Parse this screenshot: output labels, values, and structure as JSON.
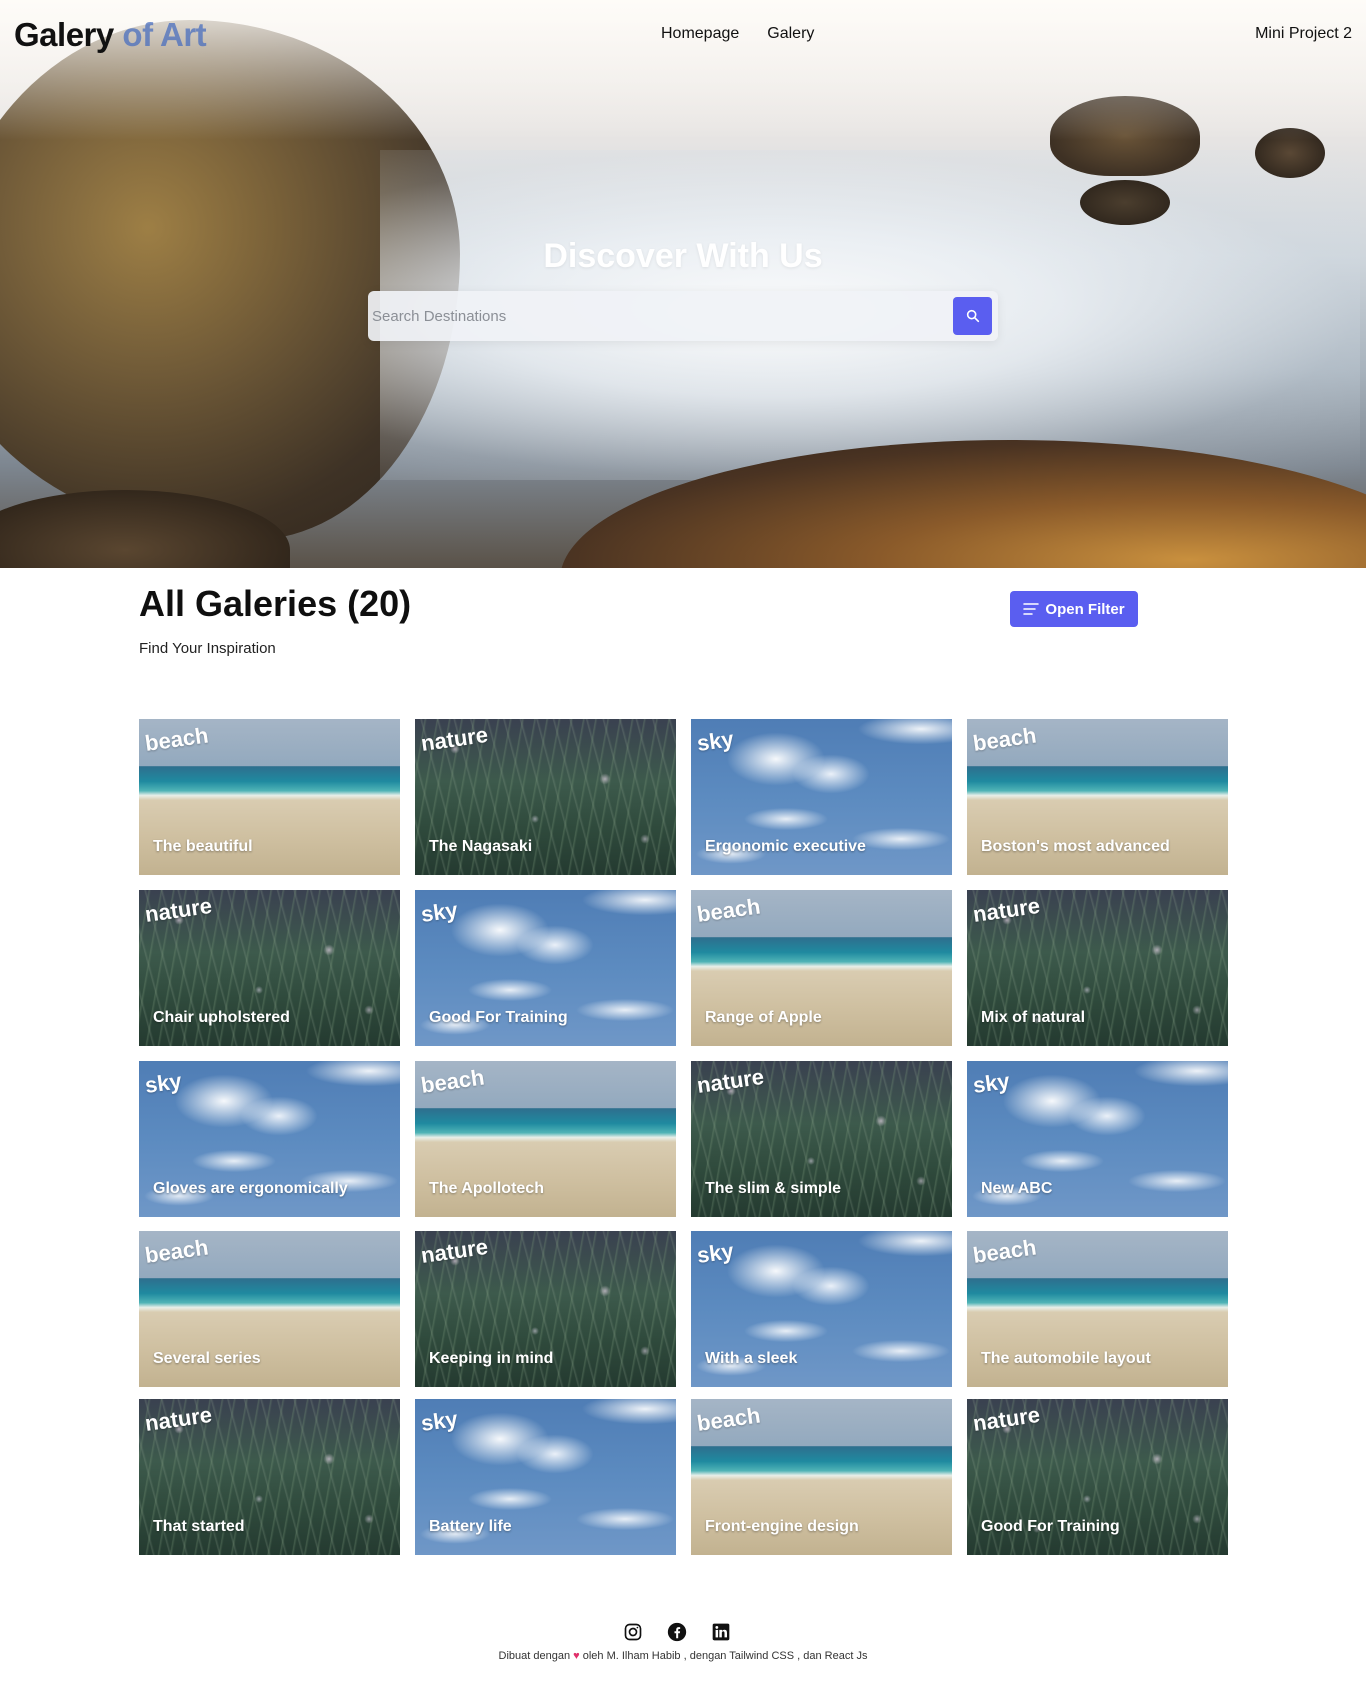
{
  "nav": {
    "logo_main": "Galery",
    "logo_accent": " of Art",
    "links": [
      "Homepage",
      "Galery"
    ],
    "right_label": "Mini Project 2"
  },
  "hero": {
    "title": "Discover With Us",
    "search_placeholder": "Search Destinations",
    "search_icon": "search-icon"
  },
  "section": {
    "title": "All Galeries (20)",
    "subtitle": "Find Your Inspiration",
    "filter_label": "Open Filter",
    "filter_icon": "filter-lines-icon"
  },
  "gallery": [
    {
      "tag": "beach",
      "title": "The beautiful"
    },
    {
      "tag": "nature",
      "title": "The Nagasaki"
    },
    {
      "tag": "sky",
      "title": "Ergonomic executive"
    },
    {
      "tag": "beach",
      "title": "Boston's most advanced"
    },
    {
      "tag": "nature",
      "title": "Chair upholstered"
    },
    {
      "tag": "sky",
      "title": "Good For Training"
    },
    {
      "tag": "beach",
      "title": "Range of Apple"
    },
    {
      "tag": "nature",
      "title": "Mix of natural"
    },
    {
      "tag": "sky",
      "title": "Gloves are ergonomically"
    },
    {
      "tag": "beach",
      "title": "The Apollotech"
    },
    {
      "tag": "nature",
      "title": "The slim & simple"
    },
    {
      "tag": "sky",
      "title": "New ABC"
    },
    {
      "tag": "beach",
      "title": "Several series"
    },
    {
      "tag": "nature",
      "title": "Keeping in mind"
    },
    {
      "tag": "sky",
      "title": "With a sleek"
    },
    {
      "tag": "beach",
      "title": "The automobile layout"
    },
    {
      "tag": "nature",
      "title": "That started"
    },
    {
      "tag": "sky",
      "title": "Battery life"
    },
    {
      "tag": "beach",
      "title": "Front-engine design"
    },
    {
      "tag": "nature",
      "title": "Good For Training"
    }
  ],
  "footer": {
    "icons": [
      "instagram-icon",
      "facebook-icon",
      "linkedin-icon"
    ],
    "text_before": "Dibuat dengan ",
    "heart": "♥",
    "text_after": " oleh M. Ilham Habib , dengan Tailwind CSS , dan React Js",
    "colors": {
      "accent": "#5a5ef0",
      "heart": "#e0306a"
    }
  }
}
